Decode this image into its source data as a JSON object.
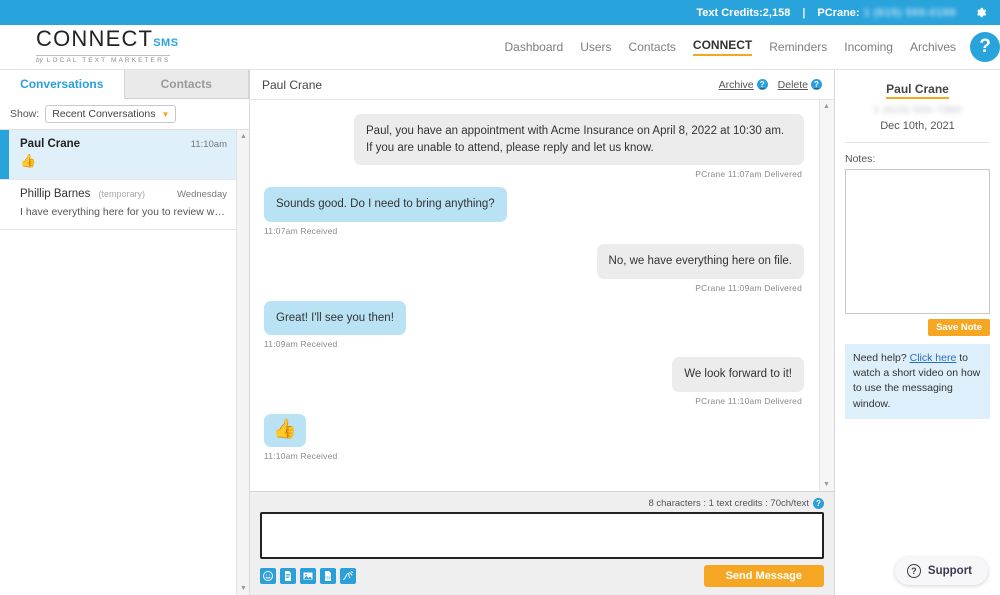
{
  "topbar": {
    "credits_label": "Text Credits:2,158",
    "divider": "|",
    "account_label": "PCrane:",
    "account_phone_redacted": "1 (615) 555-0199",
    "gear_icon": "gear-icon"
  },
  "branding": {
    "logo_main": "CONNECT",
    "logo_sms": "SMS",
    "logo_by": "by",
    "logo_sub": "LOCAL TEXT MARKETERS"
  },
  "nav": {
    "items": [
      {
        "label": "Dashboard",
        "active": false
      },
      {
        "label": "Users",
        "active": false
      },
      {
        "label": "Contacts",
        "active": false
      },
      {
        "label": "CONNECT",
        "active": true
      },
      {
        "label": "Reminders",
        "active": false
      },
      {
        "label": "Incoming",
        "active": false
      },
      {
        "label": "Archives",
        "active": false
      }
    ],
    "help_icon_label": "?"
  },
  "left_panel": {
    "tabs": [
      {
        "label": "Conversations",
        "active": true
      },
      {
        "label": "Contacts",
        "active": false
      }
    ],
    "show_label": "Show:",
    "show_value": "Recent Conversations",
    "conversations": [
      {
        "name": "Paul Crane",
        "tag": "",
        "time": "11:10am",
        "preview": "",
        "emoji": "👍",
        "selected": true
      },
      {
        "name": "Phillip Barnes",
        "tag": "(temporary)",
        "time": "Wednesday",
        "preview": "I have everything here for you to review whenever ...",
        "emoji": "",
        "selected": false
      }
    ]
  },
  "chat": {
    "title": "Paul Crane",
    "archive_label": "Archive",
    "delete_label": "Delete",
    "help_badge": "?",
    "messages": [
      {
        "direction": "out",
        "text": "Paul, you have an appointment with Acme Insurance on April 8, 2022 at 10:30 am. If you are unable to attend, please reply and let us know.",
        "meta": "PCrane  11:07am  Delivered",
        "emoji_only": false
      },
      {
        "direction": "in",
        "text": "Sounds good. Do I need to bring anything?",
        "meta": "11:07am  Received",
        "emoji_only": false
      },
      {
        "direction": "out",
        "text": "No, we have everything here on file.",
        "meta": "PCrane  11:09am  Delivered",
        "emoji_only": false
      },
      {
        "direction": "in",
        "text": "Great! I'll see you then!",
        "meta": "11:09am  Received",
        "emoji_only": false
      },
      {
        "direction": "out",
        "text": "We look forward to it!",
        "meta": "PCrane  11:10am  Delivered",
        "emoji_only": false
      },
      {
        "direction": "in",
        "text": "👍",
        "meta": "11:10am  Received",
        "emoji_only": true
      }
    ]
  },
  "compose": {
    "char_count": "8 characters : 1 text credits : 70ch/text",
    "help_badge": "?",
    "message_value": "",
    "message_placeholder": "",
    "tool_icons": [
      "emoji-icon",
      "template-icon",
      "image-icon",
      "attachment-icon",
      "signature-icon"
    ],
    "send_label": "Send Message"
  },
  "right_panel": {
    "contact_name": "Paul Crane",
    "contact_phone_redacted": "1 (615) 555-7380",
    "contact_date": "Dec 10th, 2021",
    "notes_label": "Notes:",
    "notes_value": "",
    "save_note_label": "Save Note",
    "help_text_before": "Need help? ",
    "help_link": "Click here",
    "help_text_after": " to watch a short video on how to use the messaging window."
  },
  "support_widget": {
    "label": "Support",
    "icon": "question-circle-icon"
  },
  "colors": {
    "brand_blue": "#29a3dc",
    "accent_orange": "#f5a623",
    "incoming_bubble": "#b9e3f5",
    "outgoing_bubble": "#ececec",
    "selected_row": "#dff0fb"
  }
}
